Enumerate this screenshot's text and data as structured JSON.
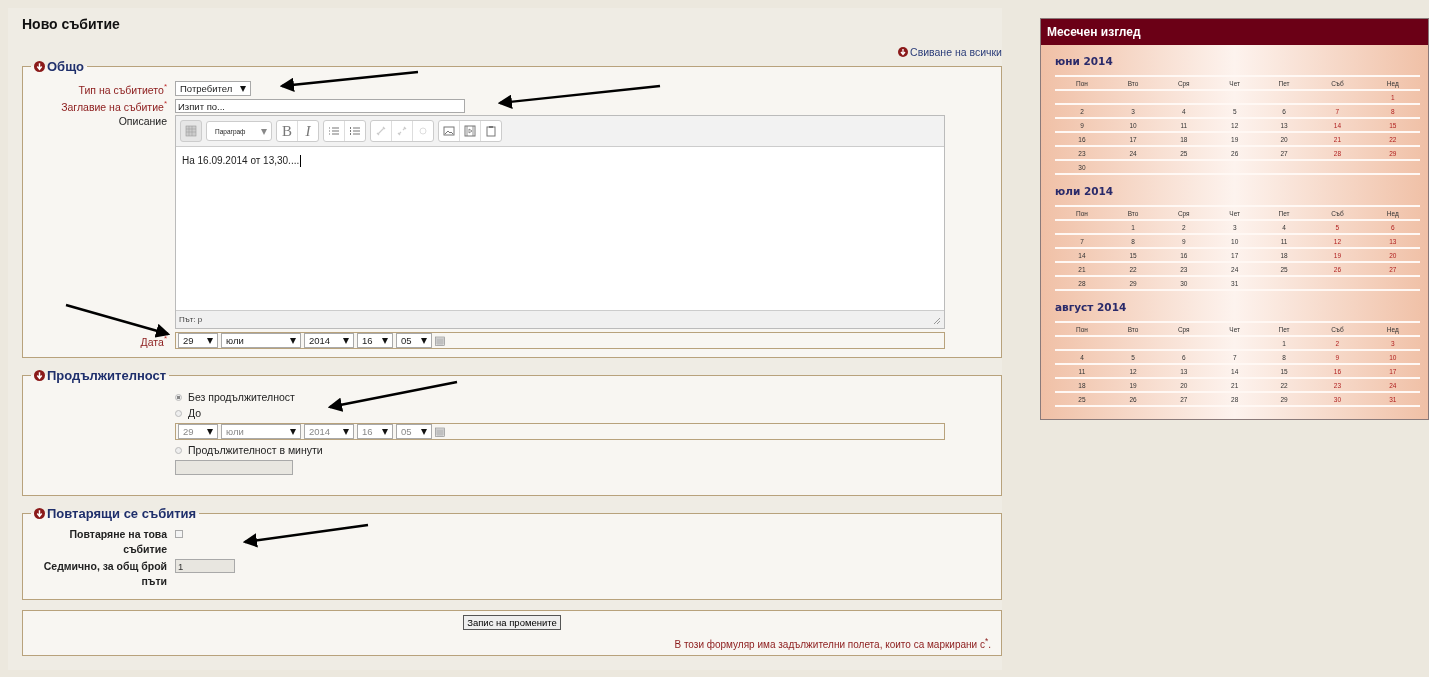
{
  "page_title": "Ново събитие",
  "collapse_all": "Свиване на всички",
  "general": {
    "legend": "Общо",
    "type": {
      "label": "Тип на събитието",
      "mark": "*",
      "value": "Потребител"
    },
    "title": {
      "label": "Заглавие на събитие",
      "mark": "*",
      "value": "Изпит по..."
    },
    "description": {
      "label": "Описание",
      "format": "Параграф",
      "bold": "B",
      "italic": "I",
      "content": "На 16.09.2014 от 13,30....",
      "path": "Път: p"
    },
    "date": {
      "label": "Дата",
      "mark": "*",
      "parts": [
        "29",
        "юли",
        "2014",
        "16",
        "05"
      ]
    }
  },
  "duration": {
    "legend": "Продължителност",
    "options": [
      {
        "label": "Без продължителност",
        "selected": true
      },
      {
        "label": "До",
        "selected": false
      },
      {
        "label": "Продължителност в минути",
        "selected": false
      }
    ],
    "until": {
      "parts": [
        "29",
        "юли",
        "2014",
        "16",
        "05"
      ],
      "disabled": true
    },
    "minutes": {
      "disabled": true
    }
  },
  "repeat": {
    "legend": "Повтарящи се събития",
    "repeat": {
      "label": "Повтаряне на това събитие",
      "checked": false
    },
    "count": {
      "label": "Седмично, за общ брой пъти",
      "value": "1",
      "disabled": true
    }
  },
  "save_button": "Запис на промените",
  "required_note": "В този формуляр има задължителни полета, които са маркирани с$^{*}$.",
  "calendar": {
    "title": "Месечен изглед",
    "months": [
      {
        "name": "юни 2014",
        "weekdays": [
          "Пон",
          "Вто",
          "Сря",
          "Чет",
          "Пет",
          "Съб",
          "Нед"
        ],
        "weeks": [
          {
            "sun": "1"
          },
          {
            "mon": "2",
            "tue": "3",
            "wed": "4",
            "thu": "5",
            "fri": "6",
            "sat": "7",
            "sun": "8"
          },
          {
            "mon": "9",
            "tue": "10",
            "wed": "11",
            "thu": "12",
            "fri": "13",
            "sat": "14",
            "sun": "15"
          },
          {
            "mon": "16",
            "tue": "17",
            "wed": "18",
            "thu": "19",
            "fri": "20",
            "sat": "21",
            "sun": "22"
          },
          {
            "mon": "23",
            "tue": "24",
            "wed": "25",
            "thu": "26",
            "fri": "27",
            "sat": "28",
            "sun": "29"
          },
          {
            "mon": "30"
          }
        ]
      },
      {
        "name": "юли 2014",
        "weekdays": [
          "Пон",
          "Вто",
          "Сря",
          "Чет",
          "Пет",
          "Съб",
          "Нед"
        ],
        "weeks": [
          {
            "tue": "1",
            "wed": "2",
            "thu": "3",
            "fri": "4",
            "sat": "5",
            "sun": "6"
          },
          {
            "mon": "7",
            "tue": "8",
            "wed": "9",
            "thu": "10",
            "fri": "11",
            "sat": "12",
            "sun": "13"
          },
          {
            "mon": "14",
            "tue": "15",
            "wed": "16",
            "thu": "17",
            "fri": "18",
            "sat": "19",
            "sun": "20"
          },
          {
            "mon": "21",
            "tue": "22",
            "wed": "23",
            "thu": "24",
            "fri": "25",
            "sat": "26",
            "sun": "27"
          },
          {
            "mon": "28",
            "tue": "29",
            "wed": "30",
            "thu": "31"
          }
        ]
      },
      {
        "name": "август 2014",
        "weekdays": [
          "Пон",
          "Вто",
          "Сря",
          "Чет",
          "Пет",
          "Съб",
          "Нед"
        ],
        "weeks": [
          {
            "fri": "1",
            "sat": "2",
            "sun": "3"
          },
          {
            "mon": "4",
            "tue": "5",
            "wed": "6",
            "thu": "7",
            "fri": "8",
            "sat": "9",
            "sun": "10"
          },
          {
            "mon": "11",
            "tue": "12",
            "wed": "13",
            "thu": "14",
            "fri": "15",
            "sat": "16",
            "sun": "17"
          },
          {
            "mon": "18",
            "tue": "19",
            "wed": "20",
            "thu": "21",
            "fri": "22",
            "sat": "23",
            "sun": "24"
          },
          {
            "mon": "25",
            "tue": "26",
            "wed": "27",
            "thu": "28",
            "fri": "29",
            "sat": "30",
            "sun": "31"
          }
        ]
      }
    ]
  }
}
